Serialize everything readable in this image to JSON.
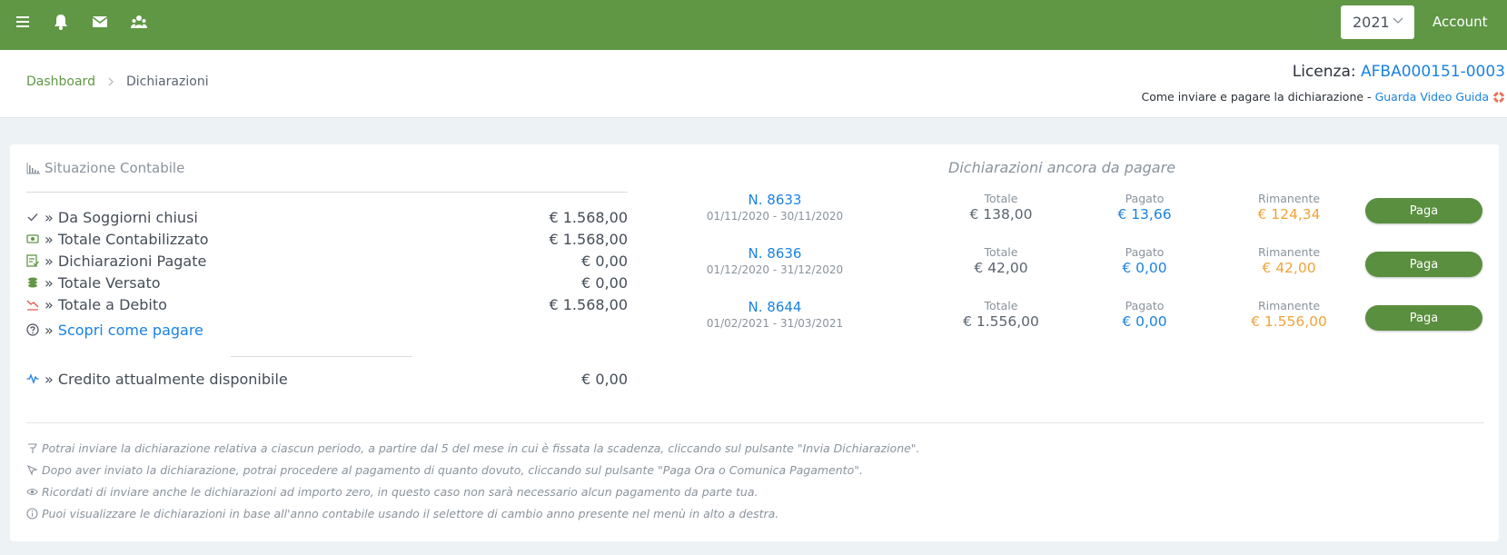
{
  "topbar": {
    "icons": [
      "menu-icon",
      "bell-icon",
      "mail-icon",
      "users-icon"
    ],
    "year": "2021",
    "account_label": "Account"
  },
  "breadcrumb": {
    "home": "Dashboard",
    "current": "Dichiarazioni"
  },
  "license": {
    "label": "Licenza:",
    "code": "AFBA000151-0003"
  },
  "guide": {
    "text": "Come inviare e pagare la dichiarazione -",
    "link": "Guarda Video Guida"
  },
  "situazione": {
    "title": "Situazione Contabile",
    "rows": [
      {
        "icon": "check-icon",
        "label": "» Da Soggiorni chiusi",
        "value": "€ 1.568,00"
      },
      {
        "icon": "money-icon",
        "label": "» Totale Contabilizzato",
        "value": "€ 1.568,00"
      },
      {
        "icon": "checklist-icon",
        "label": "» Dichiarazioni Pagate",
        "value": "€ 0,00"
      },
      {
        "icon": "coins-icon",
        "label": "» Totale Versato",
        "value": "€ 0,00"
      },
      {
        "icon": "trend-down-icon",
        "label": "» Totale a Debito",
        "value": "€ 1.568,00"
      }
    ],
    "discover_prefix": "»",
    "discover_link": "Scopri come pagare",
    "credit_label": "» Credito attualmente disponibile",
    "credit_value": "€ 0,00"
  },
  "declarations": {
    "title": "Dichiarazioni ancora da pagare",
    "headers": {
      "total": "Totale",
      "paid": "Pagato",
      "remaining": "Rimanente"
    },
    "pay_label": "Paga",
    "items": [
      {
        "number": "N. 8633",
        "period": "01/11/2020 - 30/11/2020",
        "total": "€ 138,00",
        "paid": "€ 13,66",
        "remaining": "€ 124,34"
      },
      {
        "number": "N. 8636",
        "period": "01/12/2020 - 31/12/2020",
        "total": "€ 42,00",
        "paid": "€ 0,00",
        "remaining": "€ 42,00"
      },
      {
        "number": "N. 8644",
        "period": "01/02/2021 - 31/03/2021",
        "total": "€ 1.556,00",
        "paid": "€ 0,00",
        "remaining": "€ 1.556,00"
      }
    ]
  },
  "notes": [
    "Potrai inviare la dichiarazione relativa a ciascun periodo, a partire dal 5 del mese in cui è fissata la scadenza, cliccando sul pulsante \"Invia Dichiarazione\".",
    "Dopo aver inviato la dichiarazione, potrai procedere al pagamento di quanto dovuto, cliccando sul pulsante \"Paga Ora o Comunica Pagamento\".",
    "Ricordati di inviare anche le dichiarazioni ad importo zero, in questo caso non sarà necessario alcun pagamento da parte tua.",
    "Puoi visualizzare le dichiarazioni in base all'anno contabile usando il selettore di cambio anno presente nel menù in alto a destra."
  ],
  "colors": {
    "brand_green": "#5f9744",
    "link_blue": "#1a82e2",
    "remaining_orange": "#f0a33a"
  }
}
